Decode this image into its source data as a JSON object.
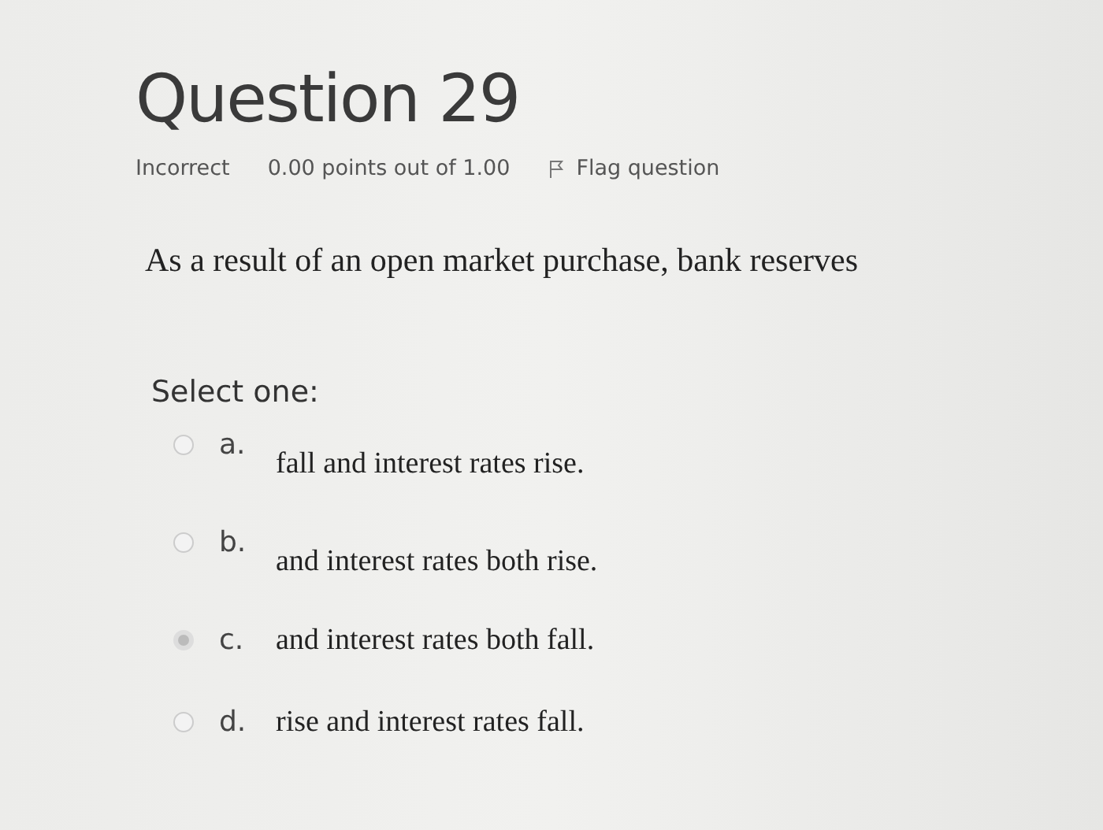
{
  "question": {
    "title": "Question 29",
    "status": "Incorrect",
    "grade": "0.00 points out of 1.00",
    "flag": {
      "label": "Flag question",
      "flagged": false
    }
  },
  "prompt": "As a result of an open market purchase, bank reserves",
  "select_label": "Select one:",
  "options": [
    {
      "letter": "a.",
      "text": "fall and interest rates rise.",
      "selected": false
    },
    {
      "letter": "b.",
      "text": "and interest rates both rise.",
      "selected": false
    },
    {
      "letter": "c.",
      "text": "and interest rates both fall.",
      "selected": true
    },
    {
      "letter": "d.",
      "text": "rise and interest rates fall.",
      "selected": false
    }
  ]
}
